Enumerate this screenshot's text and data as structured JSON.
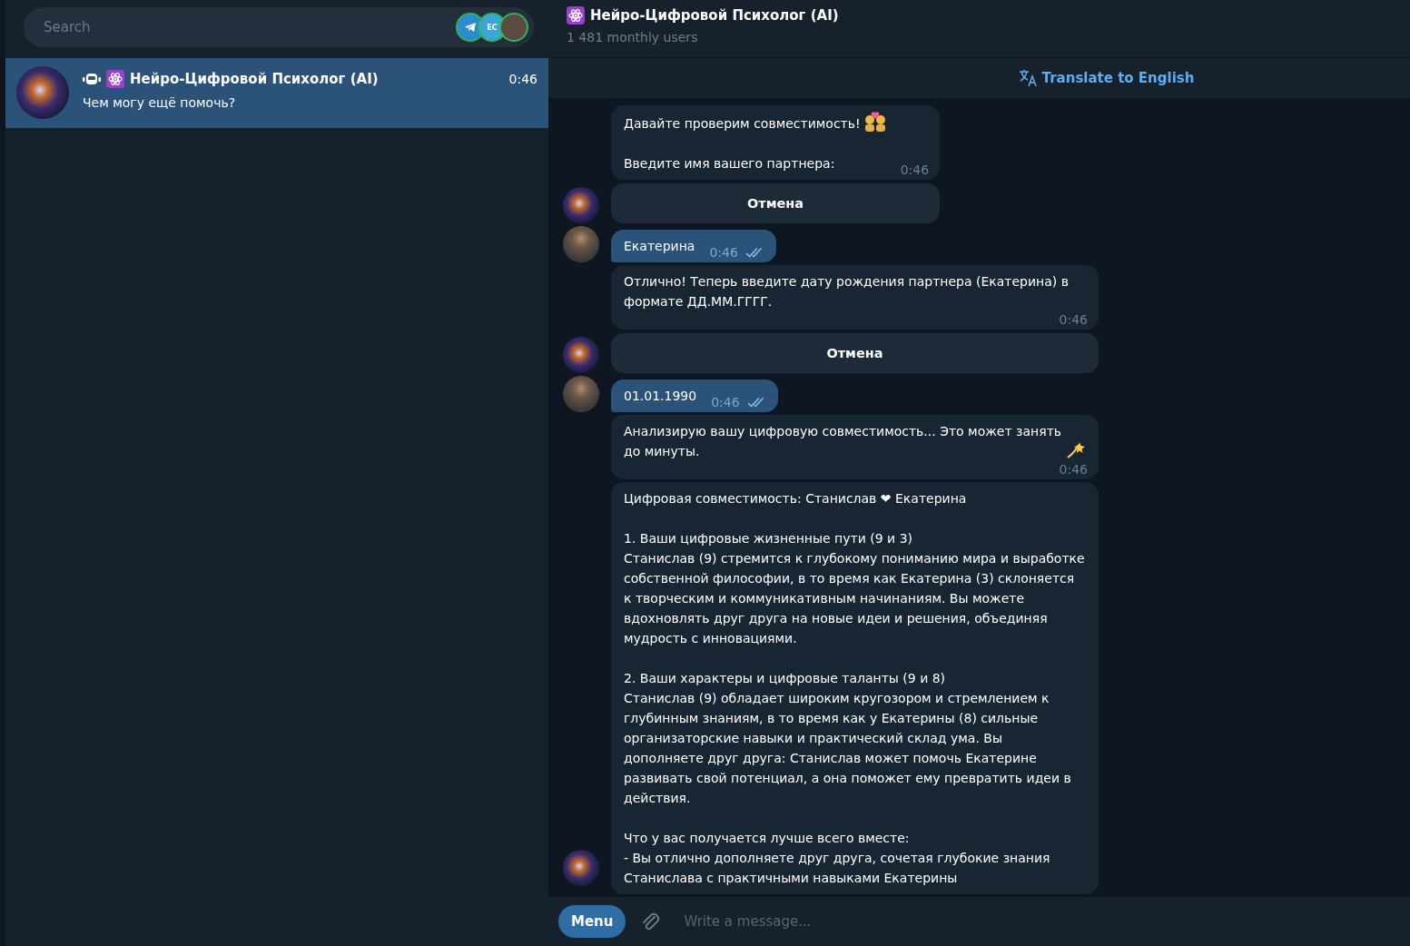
{
  "search": {
    "placeholder": "Search",
    "stories": [
      {
        "kind": "app"
      },
      {
        "kind": "initials",
        "text": "EC"
      },
      {
        "kind": "photo"
      }
    ]
  },
  "chats": [
    {
      "title": "Нейро-Цифровой Психолог (AI)",
      "bot": true,
      "time": "0:46",
      "preview": "Чем могу ещё помочь?",
      "selected": true
    }
  ],
  "header": {
    "title": "Нейро-Цифровой Психолог (AI)",
    "subtitle": "1 481 monthly users"
  },
  "translate": {
    "label": "Translate to English"
  },
  "messages": [
    {
      "kind": "bot",
      "blocks": [
        [
          {
            "text": "Давайте проверим совместимость!",
            "kind": "couple"
          }
        ],
        [
          {
            "text": "Введите имя вашего партнера:"
          }
        ]
      ],
      "time": "0:46",
      "buttons": [
        "Отмена"
      ]
    },
    {
      "kind": "user",
      "blocks": [
        [
          {
            "text": "Екатерина"
          }
        ]
      ],
      "time": "0:46",
      "read": true
    },
    {
      "kind": "bot",
      "blocks": [
        [
          {
            "text": "Отлично! Теперь введите дату рождения партнера (Екатерина) в формате ДД.ММ.ГГГГ."
          }
        ]
      ],
      "time": "0:46",
      "buttons": [
        "Отмена"
      ]
    },
    {
      "kind": "user",
      "blocks": [
        [
          {
            "text": "01.01.1990"
          }
        ]
      ],
      "time": "0:46",
      "read": true
    },
    {
      "kind": "bot",
      "blocks": [
        [
          {
            "text": "Анализирую вашу цифровую совместимость... Это может занять до минуты.",
            "kind": "sparkle"
          }
        ]
      ],
      "time": "0:46"
    },
    {
      "kind": "bot",
      "blocks": [
        [
          {
            "text": "Цифровая совместимость: Станислав ❤ Екатерина"
          }
        ],
        [
          {
            "text": "1. Ваши цифровые жизненные пути (9 и 3)"
          },
          {
            "text": "Станислав (9) стремится к глубокому пониманию мира и выработке собственной философии, в то время как Екатерина (3) склоняется к творческим и коммуникативным начинаниям. Вы можете вдохновлять друг друга на новые идеи и решения, объединяя мудрость с инновациями."
          }
        ],
        [
          {
            "text": "2. Ваши характеры и цифровые таланты (9 и 8)"
          },
          {
            "text": "Станислав (9) обладает широким кругозором и стремлением к глубинным знаниям, в то время как у Екатерины (8) сильные организаторские навыки и практический склад ума. Вы дополняете друг друга: Станислав может помочь Екатерине развивать свой потенциал, а она поможет ему превратить идеи в действия."
          }
        ],
        [
          {
            "text": "Что у вас получается лучше всего вместе:"
          },
          {
            "text": "- Вы отлично дополняете друг друга, сочетая глубокие знания"
          },
          {
            "text": "Станислава с практичными навыками Екатерины"
          }
        ]
      ]
    }
  ],
  "composer": {
    "menu": "Menu",
    "placeholder": "Write a message..."
  }
}
